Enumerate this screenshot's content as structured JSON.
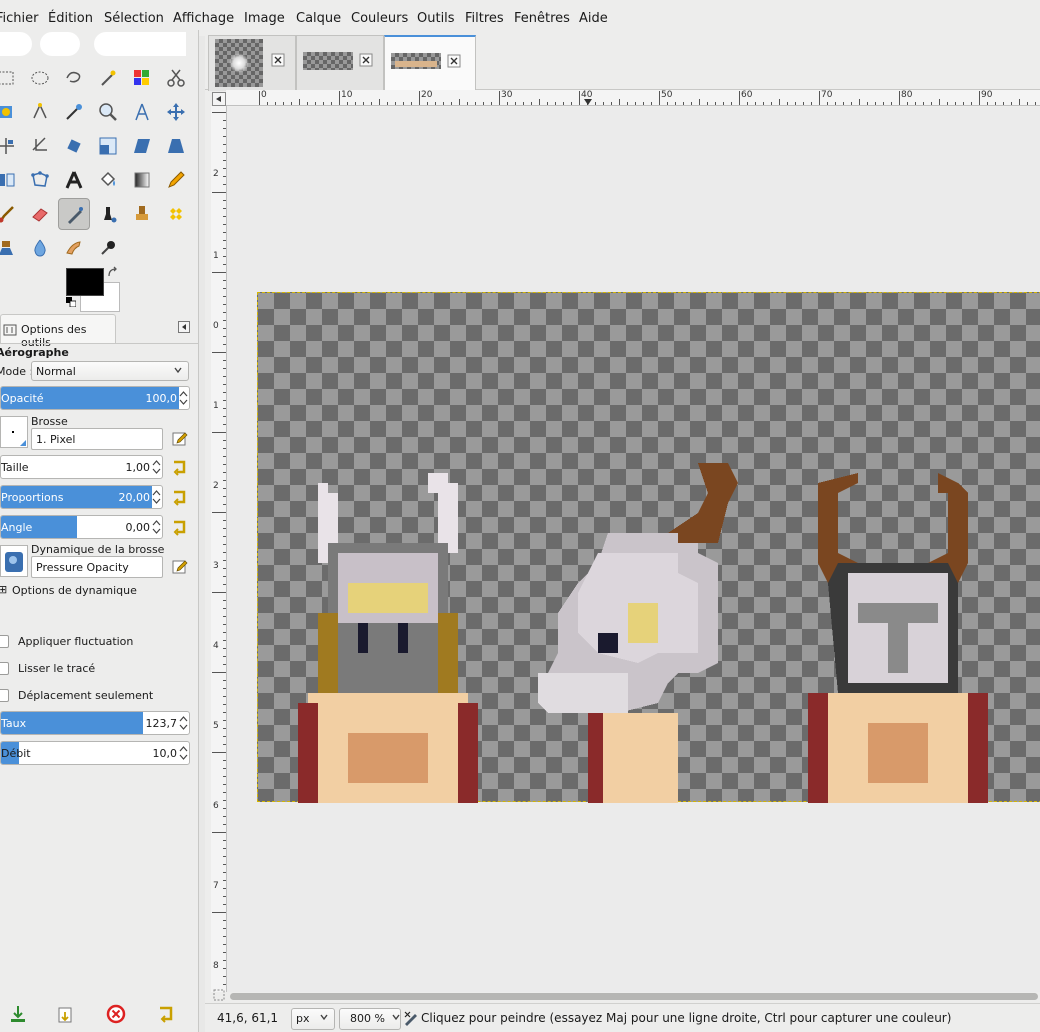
{
  "menubar": {
    "items": [
      "Fichier",
      "Édition",
      "Sélection",
      "Affichage",
      "Image",
      "Calque",
      "Couleurs",
      "Outils",
      "Filtres",
      "Fenêtres",
      "Aide"
    ]
  },
  "colors": {
    "accent": "#4a90d9",
    "foreground_color": "#000000",
    "background_color": "#ffffff",
    "selection_border": "#d4b600"
  },
  "toolbox": {
    "tools": [
      "rect-select-icon",
      "ellipse-select-icon",
      "free-select-icon",
      "fuzzy-select-icon",
      "select-by-color-icon",
      "scissors-icon",
      "foreground-select-icon",
      "paths-icon",
      "color-picker-icon",
      "zoom-icon",
      "measure-icon",
      "move-icon",
      "align-icon",
      "crop-icon",
      "rotate-icon",
      "scale-icon",
      "shear-icon",
      "perspective-icon",
      "flip-icon",
      "cage-transform-icon",
      "text-icon",
      "bucket-fill-icon",
      "blend-icon",
      "pencil-icon",
      "paintbrush-icon",
      "eraser-icon",
      "airbrush-icon",
      "ink-icon",
      "clone-icon",
      "heal-icon",
      "perspective-clone-icon",
      "blur-icon",
      "smudge-icon",
      "dodge-burn-icon"
    ],
    "active_tool": "airbrush-icon"
  },
  "tool_options": {
    "tab_label": "Options des outils",
    "tool_name": "Aérographe",
    "mode_label": "Mode :",
    "mode_value": "Normal",
    "opacity": {
      "label": "Opacité",
      "value": "100,0",
      "fraction": 1.0
    },
    "brush_label": "Brosse",
    "brush_value": "1. Pixel",
    "size": {
      "label": "Taille",
      "value": "1,00",
      "fraction": 0.0
    },
    "aspect": {
      "label": "Proportions",
      "value": "20,00",
      "fraction": 1.0
    },
    "angle": {
      "label": "Angle",
      "value": "0,00",
      "fraction": 0.5
    },
    "dynamics_label": "Dynamique de la brosse",
    "dynamics_value": "Pressure Opacity",
    "dynamics_options": "Options de dynamique",
    "apply_jitter": "Appliquer fluctuation",
    "smooth_stroke": "Lisser le tracé",
    "lock_brush": "Déplacement seulement",
    "rate": {
      "label": "Taux",
      "value": "123,7",
      "fraction": 0.8
    },
    "flow": {
      "label": "Débit",
      "value": "10,0",
      "fraction": 0.1
    }
  },
  "image_tabs": [
    {
      "name": "tab-image-1",
      "active": false
    },
    {
      "name": "tab-image-2",
      "active": false
    },
    {
      "name": "tab-image-3",
      "active": true
    }
  ],
  "rulers": {
    "h_labels": [
      "0",
      "10",
      "20",
      "30",
      "40",
      "50",
      "60",
      "70",
      "80",
      "90"
    ],
    "v_labels": [
      "2",
      "1",
      "0",
      "1",
      "2",
      "3",
      "4",
      "5",
      "6",
      "7",
      "8"
    ]
  },
  "statusbar": {
    "coords": "41,6, 61,1",
    "unit": "px",
    "zoom": "800 %",
    "message": "Cliquez pour peindre (essayez Maj pour une ligne droite, Ctrl pour capturer une couleur)"
  }
}
